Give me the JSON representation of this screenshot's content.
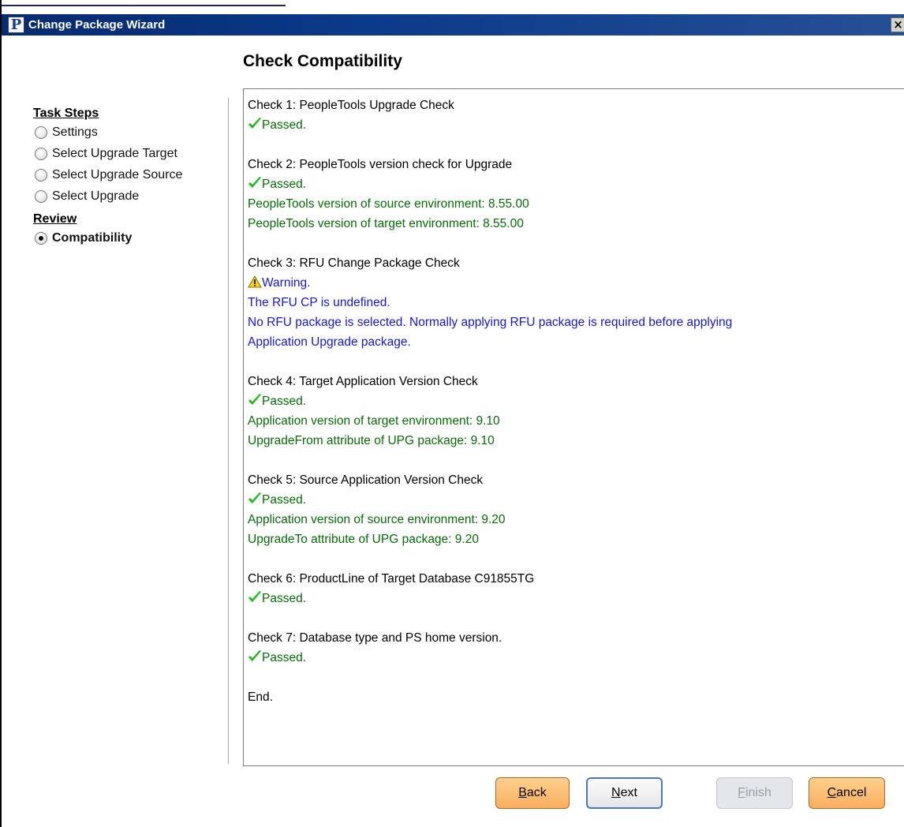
{
  "window": {
    "title": "Change Package Wizard",
    "app_icon_letter": "P",
    "close_glyph": "×"
  },
  "page": {
    "heading": "Check Compatibility"
  },
  "sidebar": {
    "task_steps_title": "Task Steps",
    "steps": [
      {
        "label": "Settings",
        "selected": false
      },
      {
        "label": "Select Upgrade Target",
        "selected": false
      },
      {
        "label": "Select Upgrade Source",
        "selected": false
      },
      {
        "label": "Select Upgrade",
        "selected": false
      }
    ],
    "review_title": "Review",
    "review_steps": [
      {
        "label": "Compatibility",
        "selected": true
      }
    ]
  },
  "results": {
    "check1": {
      "title": "Check 1: PeopleTools Upgrade Check",
      "status": "Passed."
    },
    "check2": {
      "title": "Check 2: PeopleTools version check for Upgrade",
      "status": "Passed.",
      "details": [
        "PeopleTools version of source environment: 8.55.00",
        "PeopleTools version of target environment: 8.55.00"
      ]
    },
    "check3": {
      "title": "Check 3: RFU Change Package Check",
      "status": "Warning.",
      "details": [
        "The RFU CP is undefined.",
        "No RFU package is selected. Normally applying RFU package is required before applying",
        "Application Upgrade package."
      ]
    },
    "check4": {
      "title": "Check 4: Target Application Version Check",
      "status": "Passed.",
      "details": [
        "Application version of target environment: 9.10",
        "UpgradeFrom attribute of UPG package: 9.10"
      ]
    },
    "check5": {
      "title": "Check 5: Source Application Version Check",
      "status": "Passed.",
      "details": [
        "Application version of source environment: 9.20",
        "UpgradeTo attribute of UPG package: 9.20"
      ]
    },
    "check6": {
      "title": "Check 6: ProductLine of Target Database C91855TG",
      "status": "Passed."
    },
    "check7": {
      "title": "Check 7: Database type and PS home version.",
      "status": "Passed."
    },
    "end": "End."
  },
  "buttons": {
    "back": {
      "mnemonic": "B",
      "rest": "ack"
    },
    "next": {
      "mnemonic": "N",
      "rest": "ext"
    },
    "finish": {
      "mnemonic": "F",
      "rest": "inish"
    },
    "cancel": {
      "mnemonic": "C",
      "rest": "ancel"
    }
  },
  "colors": {
    "passed": "#0a6a0a",
    "warning": "#1818c8",
    "check_icon": "#22b81f",
    "warn_icon": "#f2d21a"
  }
}
